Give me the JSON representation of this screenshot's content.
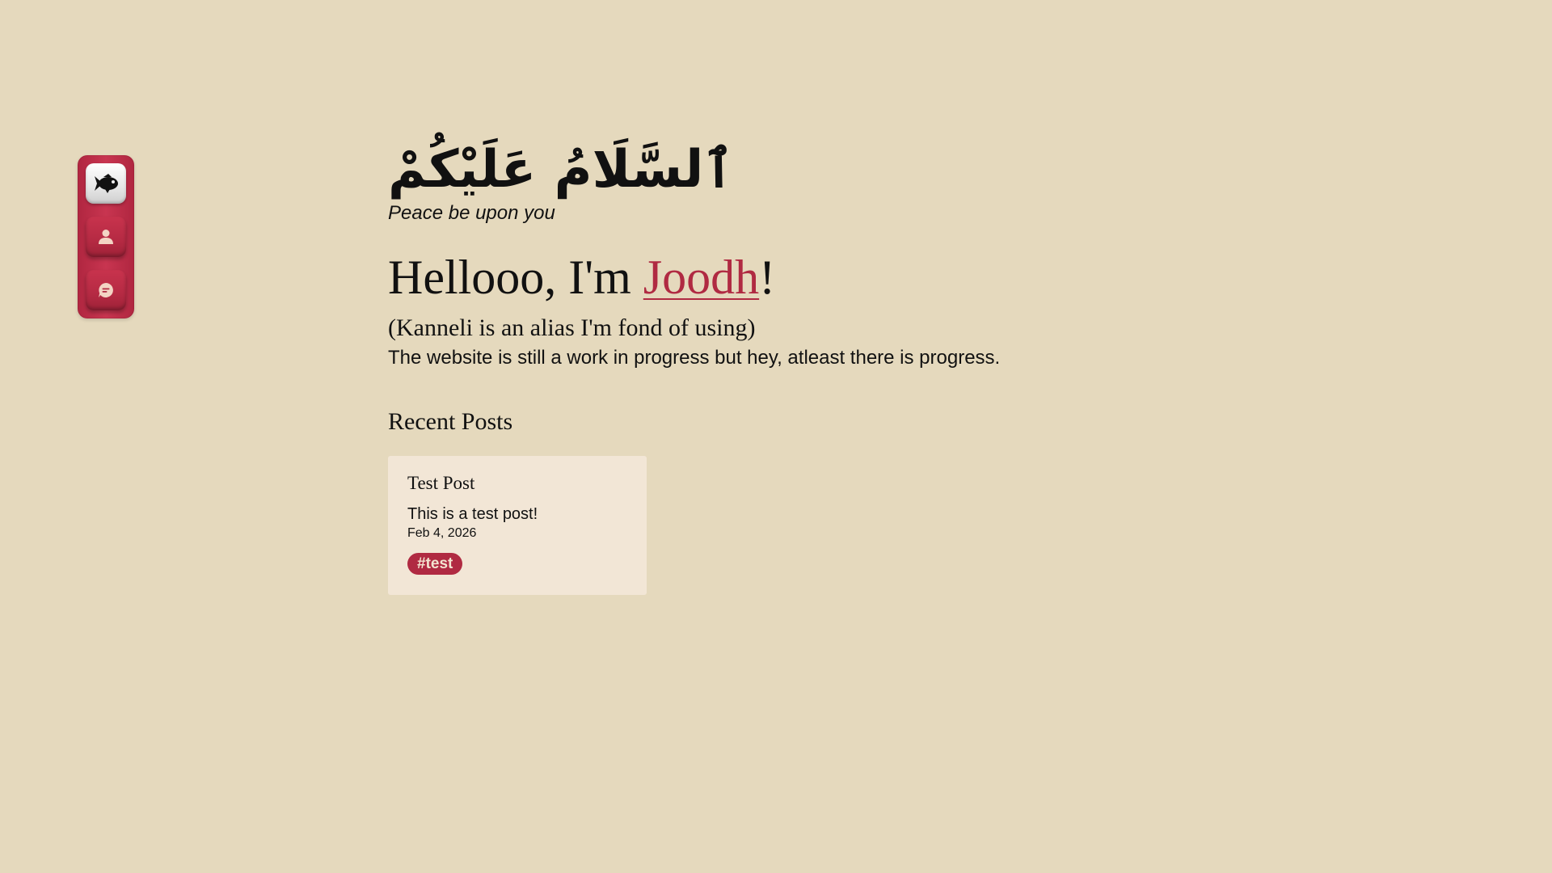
{
  "sidebar": {
    "items": [
      {
        "name": "home",
        "icon": "fish-icon"
      },
      {
        "name": "about",
        "icon": "person-icon"
      },
      {
        "name": "chat",
        "icon": "chat-bubble-icon"
      }
    ],
    "colors": {
      "accent": "#b02a42",
      "icon_light": "#f3d4c4",
      "home_bg": "#f0f0f0"
    }
  },
  "hero": {
    "greeting_arabic": "ٱلسَّلَامُ عَلَيْكُمْ",
    "greeting_translation": "Peace be upon you",
    "hello_prefix": "Hellooo, I'm ",
    "name": "Joodh",
    "hello_suffix": "!",
    "alias_note": "(Kanneli is an alias I'm fond of using)",
    "status_note": "The website is still a work in progress but hey, atleast there is progress."
  },
  "recent_posts": {
    "heading": "Recent Posts",
    "posts": [
      {
        "title": "Test Post",
        "description": "This is a test post!",
        "date": "Feb 4, 2026",
        "tags": [
          "#test"
        ]
      }
    ]
  },
  "theme": {
    "background": "#e5d9bd",
    "card_background": "#f2e6d6",
    "accent": "#b02a42"
  }
}
